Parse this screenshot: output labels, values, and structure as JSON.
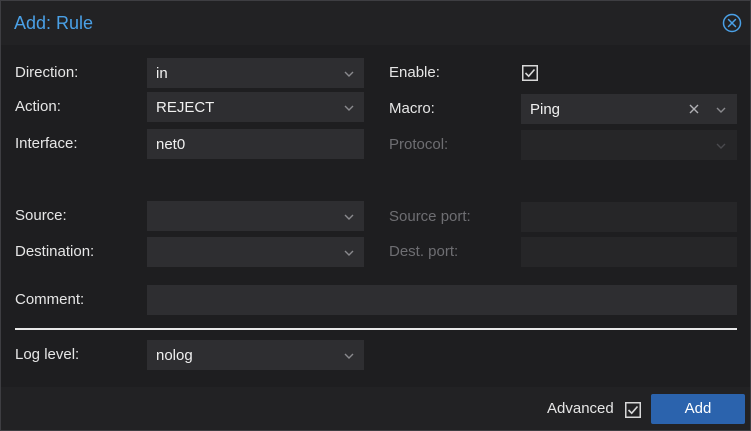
{
  "dialog": {
    "title": "Add: Rule"
  },
  "colors": {
    "title": "#4aa0e6",
    "accent_button": "#2b63ad",
    "field_bg": "#2e2e31",
    "panel_bg": "#1e1e20",
    "text": "#e6e6e6",
    "disabled_text": "#6e6e72"
  },
  "form": {
    "direction": {
      "label": "Direction:",
      "value": "in"
    },
    "action": {
      "label": "Action:",
      "value": "REJECT"
    },
    "interface": {
      "label": "Interface:",
      "value": "net0"
    },
    "enable": {
      "label": "Enable:",
      "checked": true
    },
    "macro": {
      "label": "Macro:",
      "value": "Ping"
    },
    "protocol": {
      "label": "Protocol:",
      "value": "",
      "disabled": true
    },
    "source": {
      "label": "Source:",
      "value": ""
    },
    "destination": {
      "label": "Destination:",
      "value": ""
    },
    "source_port": {
      "label": "Source port:",
      "value": "",
      "disabled": true
    },
    "dest_port": {
      "label": "Dest. port:",
      "value": "",
      "disabled": true
    },
    "comment": {
      "label": "Comment:",
      "value": ""
    },
    "log_level": {
      "label": "Log level:",
      "value": "nolog"
    }
  },
  "footer": {
    "advanced_label": "Advanced",
    "advanced_checked": true,
    "add_label": "Add"
  },
  "icons": {
    "close": "close-circle-icon",
    "dropdown": "chevron-down-icon",
    "clear": "clear-x-icon",
    "check": "checkbox-checked-icon"
  }
}
